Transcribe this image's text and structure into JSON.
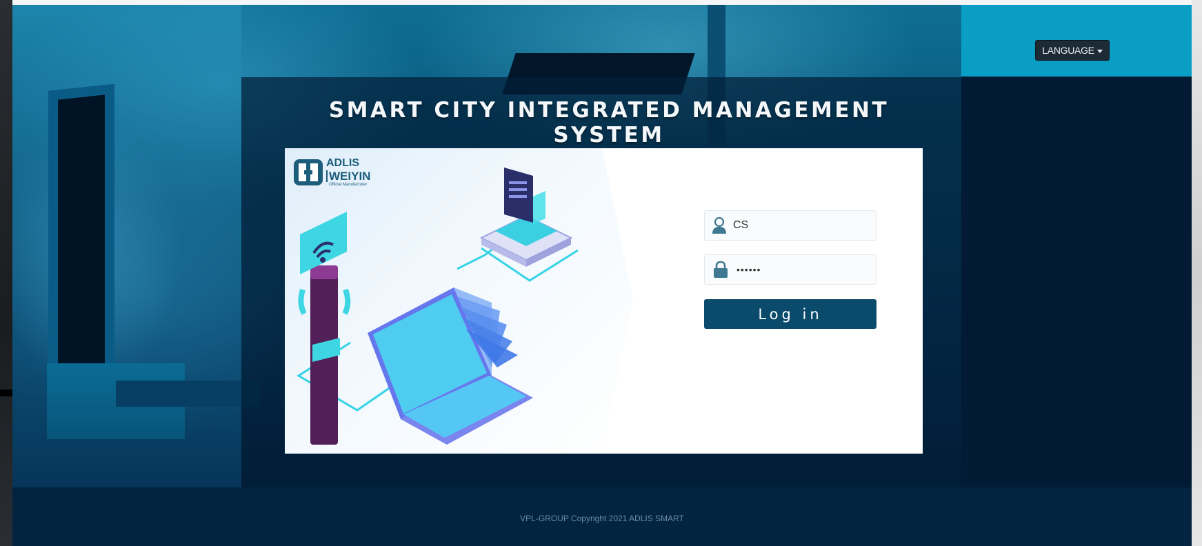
{
  "header": {
    "language_button": "LANGUAGE",
    "title": "SMART CITY INTEGRATED MANAGEMENT SYSTEM"
  },
  "brand": {
    "line1": "ADLIS",
    "line2": "WEIYIN",
    "line3": "Official Manufacturer"
  },
  "login": {
    "username_value": "CS",
    "password_value": "••••••",
    "submit_label": "Log in"
  },
  "footer": {
    "copyright": "VPL-GROUP Copyright 2021 ADLIS SMART"
  },
  "colors": {
    "primary_button": "#0a4b6b",
    "page_background": "#021a33",
    "accent_teal": "#0a9ec4",
    "brand_text": "#1c5d7c"
  },
  "icons": {
    "username": "user-icon",
    "password": "lock-icon",
    "dropdown": "caret-down-icon"
  }
}
